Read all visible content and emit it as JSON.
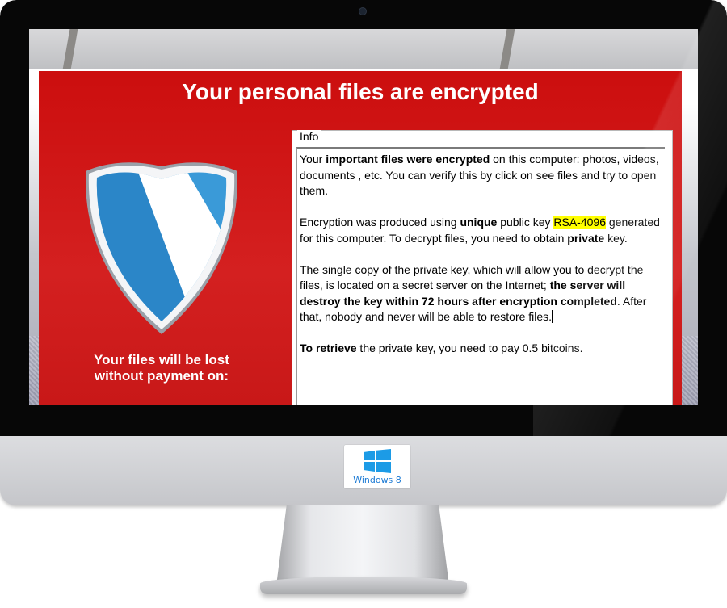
{
  "ransom_window": {
    "title": "Your personal files are encrypted",
    "left_panel": {
      "shield_icon": "shield-icon",
      "warning_line1": "Your files will be lost",
      "warning_line2": "without payment on:"
    },
    "info_panel": {
      "legend": "Info",
      "p1": {
        "t1": "Your ",
        "b1": "important files were encrypted",
        "t2": " on this computer: photos, videos, documents , etc. You can verify this by click on see files and try to open them."
      },
      "p2": {
        "t1": "Encryption was produced using ",
        "b1": "unique",
        "t2": " public key ",
        "key": "RSA-4096",
        "t3": " generated for this computer. To decrypt files, you need to obtain ",
        "b2": "private",
        "t4": " key."
      },
      "p3": {
        "t1": "The single copy of the private key, which will allow you to decrypt the files, is located on a secret server on the Internet; ",
        "b1": "the server will destroy the key within 72 hours after encryption completed",
        "t2": ". After that, nobody and never will be able to restore files."
      },
      "p4": {
        "b1": "To retrieve",
        "t1": " the private key, you need to pay 0.5 bitcoins."
      }
    }
  },
  "monitor": {
    "os_badge_label": "Windows 8",
    "os_logo_icon": "windows-logo-icon"
  },
  "colors": {
    "ransom_red": "#cc0e0e",
    "highlight": "#ffff00",
    "shield_blue": "#2f8fd1",
    "windows_blue": "#1c7ad4"
  }
}
